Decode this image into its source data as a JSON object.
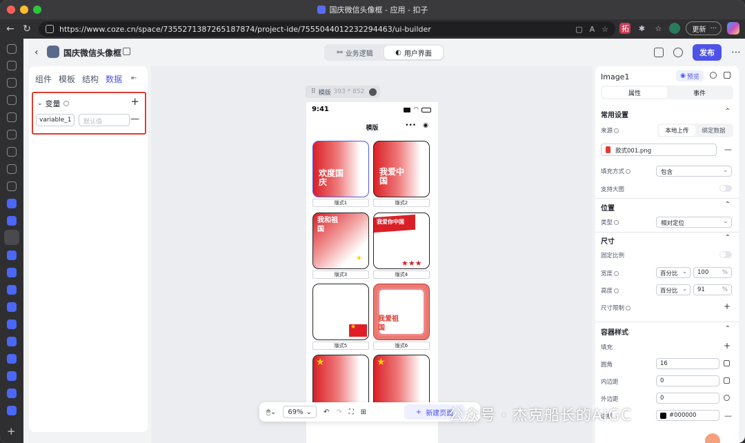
{
  "browser": {
    "tab_title": "国庆微信头像框 - 应用 - 扣子",
    "url": "https://www.coze.cn/space/7355271387265187874/project-ide/7555044012232294463/ui-builder",
    "update_label": "更新"
  },
  "header": {
    "project_title": "国庆微信头像框",
    "tabs": [
      {
        "label": "业务逻辑",
        "active": false
      },
      {
        "label": "用户界面",
        "active": true
      }
    ],
    "publish_label": "发布"
  },
  "left_panel": {
    "tabs": [
      {
        "label": "组件"
      },
      {
        "label": "模板"
      },
      {
        "label": "结构"
      },
      {
        "label": "数据",
        "active": true
      }
    ],
    "variables": {
      "title": "变量",
      "items": [
        {
          "name": "variable_1",
          "default_placeholder": "默认值"
        }
      ]
    }
  },
  "canvas": {
    "frame_name": "模版",
    "frame_size": "393 * 852",
    "phone": {
      "time": "9:41",
      "page_title": "模版",
      "cards": [
        {
          "caption": "版式1",
          "art_text": "欢度国庆"
        },
        {
          "caption": "版式2",
          "art_text": "我爱中国"
        },
        {
          "caption": "版式3",
          "art_text": "我和祖国"
        },
        {
          "caption": "版式4",
          "art_text": "我爱你中国"
        },
        {
          "caption": "版式5",
          "art_text": ""
        },
        {
          "caption": "版式6",
          "art_text": "我爱祖国"
        },
        {
          "caption": "",
          "art_text": ""
        },
        {
          "caption": "",
          "art_text": ""
        }
      ]
    }
  },
  "toolbar": {
    "zoom": "69%",
    "new_page_label": "新建页面"
  },
  "watermark": "公众号 · 杰克船长的AIGC",
  "right_panel": {
    "component_name": "Image1",
    "preview_label": "预览",
    "tabs": [
      {
        "label": "属性",
        "active": true
      },
      {
        "label": "事件",
        "active": false
      }
    ],
    "common": {
      "title": "常用设置",
      "source_label": "来源",
      "source_options": [
        {
          "label": "本地上传",
          "active": true
        },
        {
          "label": "绑定数据",
          "active": false
        }
      ],
      "file_name": "款式001.png",
      "fill_label": "填充方式",
      "fill_value": "包含",
      "zoom_label": "支持大图"
    },
    "position": {
      "title": "位置",
      "type_label": "类型",
      "type_value": "相对定位"
    },
    "size": {
      "title": "尺寸",
      "lock_label": "固定比例",
      "width_label": "宽度",
      "width_unit": "百分比",
      "width_value": "100",
      "height_label": "高度",
      "height_unit": "百分比",
      "height_value": "91",
      "unit_symbol": "%",
      "limit_label": "尺寸限制"
    },
    "container": {
      "title": "容器样式",
      "fill_label": "填充",
      "radius_label": "圆角",
      "radius_value": "16",
      "padding_label": "内边距",
      "padding_value": "0",
      "margin_label": "外边距",
      "margin_value": "0",
      "border_label": "边框",
      "border_value": "#000000"
    }
  }
}
